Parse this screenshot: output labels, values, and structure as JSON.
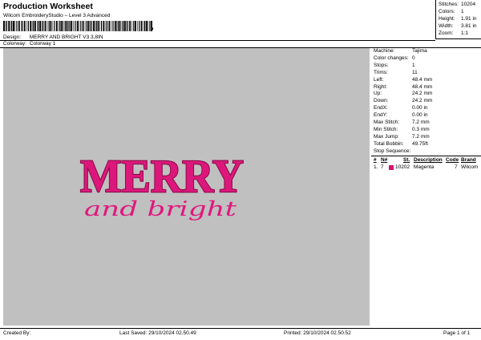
{
  "header": {
    "title": "Production Worksheet",
    "subtitle": "Wilcom EmbroideryStudio – Level 3 Advanced",
    "design_label": "Design:",
    "design_value": "MERRY AND BRIGHT V3 3,8IN",
    "colorway_label": "Colorway:",
    "colorway_value": "Colorway 1"
  },
  "stats": {
    "stitches_label": "Stitches:",
    "stitches_value": "10204",
    "colors_label": "Colors:",
    "colors_value": "1",
    "height_label": "Height:",
    "height_value": "1.91 in",
    "width_label": "Width:",
    "width_value": "3.81 in",
    "zoom_label": "Zoom:",
    "zoom_value": "1:1"
  },
  "design": {
    "main_text": "MERRY",
    "script_text": "and bright",
    "thread_color": "#e0187e",
    "background_color": "#c0c0c0"
  },
  "panel": {
    "rows": [
      {
        "label": "Machine:",
        "value": "Tajima"
      },
      {
        "label": "Color changes:",
        "value": "0"
      },
      {
        "label": "Stops:",
        "value": "1"
      },
      {
        "label": "Trims:",
        "value": "11"
      },
      {
        "label": "Left:",
        "value": "48.4 mm"
      },
      {
        "label": "Right:",
        "value": "48.4 mm"
      },
      {
        "label": "Up:",
        "value": "24.2 mm"
      },
      {
        "label": "Down:",
        "value": "24.2 mm"
      },
      {
        "label": "EndX:",
        "value": "0.00 in"
      },
      {
        "label": "EndY:",
        "value": "0.00 in"
      },
      {
        "label": "Max Stitch:",
        "value": "7.2 mm"
      },
      {
        "label": "Min Stitch:",
        "value": "0.3 mm"
      },
      {
        "label": "Max Jump:",
        "value": "7.2 mm"
      },
      {
        "label": "Total Bobbin:",
        "value": "49.75ft"
      }
    ],
    "stop_sequence_label": "Stop Sequence:",
    "seq_headers": {
      "num": "#",
      "n": "N#",
      "st": "St.",
      "desc": "Description",
      "code": "Code",
      "brand": "Brand"
    },
    "seq_rows": [
      {
        "num": "1.",
        "n": "7",
        "st": "10202",
        "desc": "Magenta",
        "code": "7",
        "brand": "Wilcom",
        "color": "#d4146e"
      }
    ]
  },
  "footer": {
    "created_by": "Created By:",
    "last_saved": "Last Saved: 29/10/2024 02.50.49",
    "printed": "Printed: 29/10/2024 02.50.52",
    "page": "Page 1 of 1"
  }
}
